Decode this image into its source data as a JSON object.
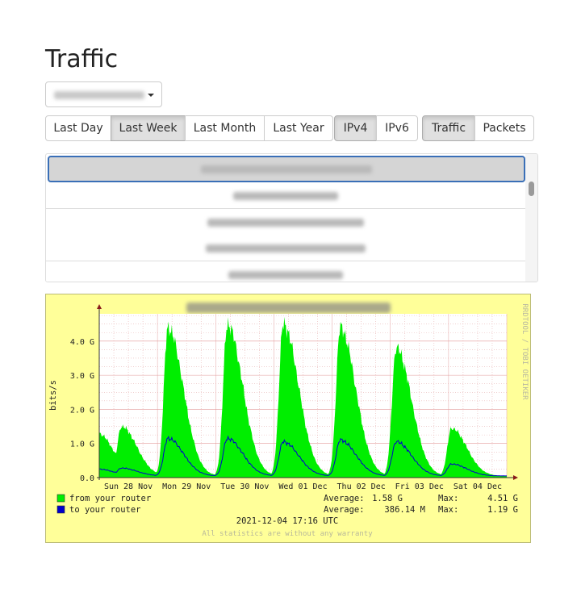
{
  "page": {
    "title": "Traffic"
  },
  "selector": {
    "value_redacted": true
  },
  "period_buttons": [
    {
      "label": "Last Day",
      "active": false
    },
    {
      "label": "Last Week",
      "active": true
    },
    {
      "label": "Last Month",
      "active": false
    },
    {
      "label": "Last Year",
      "active": false
    }
  ],
  "protocol_buttons": [
    {
      "label": "IPv4",
      "active": true
    },
    {
      "label": "IPv6",
      "active": false
    }
  ],
  "type_buttons": [
    {
      "label": "Traffic",
      "active": true
    },
    {
      "label": "Packets",
      "active": false
    }
  ],
  "list": {
    "items_visible": 5,
    "selected_index": 0,
    "text_redacted": true
  },
  "graph": {
    "watermark": "RRDTOOL / TOBI OETIKER",
    "legend": {
      "from": {
        "label": "from your router",
        "average": "1.58 G",
        "max": "4.51 G"
      },
      "to": {
        "label": "to your router",
        "average": "386.14 M",
        "max": "1.19 G"
      },
      "average_label": "Average:",
      "max_label": "Max:"
    },
    "timestamp": "2021-12-04 17:16 UTC",
    "footer": "All statistics are without any warranty",
    "colors": {
      "background": "#ffff99",
      "canvas": "#ffffff",
      "from": "#00ee00",
      "to": "#0000cc",
      "grid": "#e8b3b3"
    }
  },
  "chart_data": {
    "type": "area",
    "title": "",
    "ylabel": "bits/s",
    "ylim": [
      0,
      4.8
    ],
    "y_unit": "G",
    "yticks": [
      "0.0",
      "1.0 G",
      "2.0 G",
      "3.0 G",
      "4.0 G"
    ],
    "xticks": [
      "Sun 28 Nov",
      "Mon 29 Nov",
      "Tue 30 Nov",
      "Wed 01 Dec",
      "Thu 02 Dec",
      "Fri 03 Dec",
      "Sat 04 Dec"
    ],
    "x_range_days": [
      0,
      7.0
    ],
    "series": [
      {
        "name": "from your router",
        "color": "#00ee00",
        "days": [
          {
            "peak": 1.3,
            "peak_x": -0.02
          },
          {
            "peak": 1.5,
            "peak_x": 0.38
          },
          {
            "peak": 4.4,
            "peak_x": 1.18
          },
          {
            "peak": 4.5,
            "peak_x": 2.2
          },
          {
            "peak": 4.5,
            "peak_x": 3.16
          },
          {
            "peak": 4.4,
            "peak_x": 4.14
          },
          {
            "peak": 3.8,
            "peak_x": 5.1
          },
          {
            "peak": 1.45,
            "peak_x": 6.05
          }
        ],
        "baseline": 0.05
      },
      {
        "name": "to your router",
        "color": "#0000cc",
        "days": [
          {
            "peak": 0.25,
            "peak_x": -0.02
          },
          {
            "peak": 0.28,
            "peak_x": 0.38
          },
          {
            "peak": 1.15,
            "peak_x": 1.18
          },
          {
            "peak": 1.15,
            "peak_x": 2.2
          },
          {
            "peak": 1.05,
            "peak_x": 3.16
          },
          {
            "peak": 1.1,
            "peak_x": 4.14
          },
          {
            "peak": 1.05,
            "peak_x": 5.1
          },
          {
            "peak": 0.4,
            "peak_x": 6.05
          }
        ],
        "baseline": 0.05
      }
    ]
  }
}
